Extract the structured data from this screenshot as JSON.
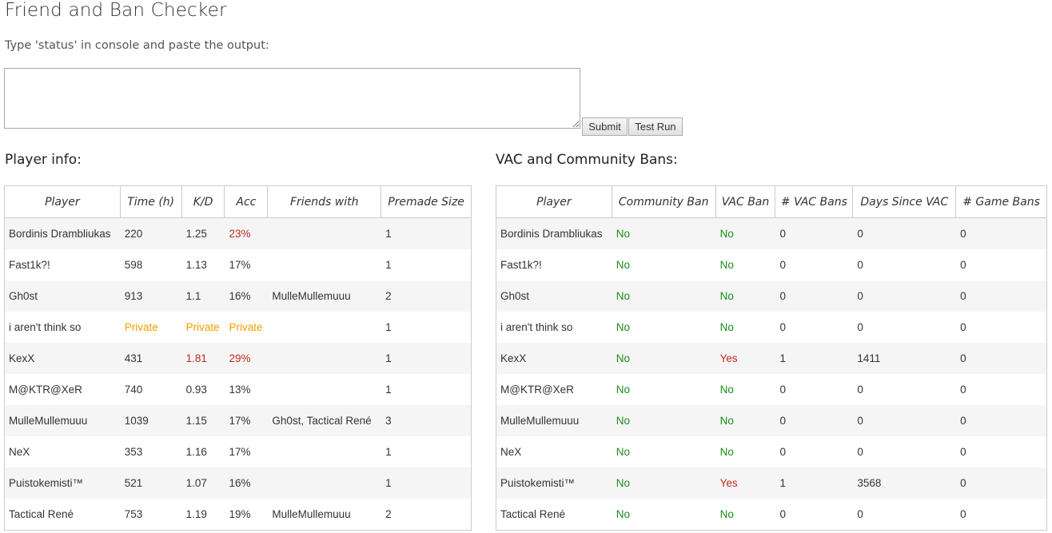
{
  "page": {
    "title": "Friend and Ban Checker",
    "instruction": "Type 'status' in console and paste the output:",
    "console_value": "",
    "submit_label": "Submit",
    "testrun_label": "Test Run"
  },
  "player_info": {
    "heading": "Player info:",
    "columns": [
      "Player",
      "Time (h)",
      "K/D",
      "Acc",
      "Friends with",
      "Premade Size"
    ],
    "rows": [
      {
        "player": "Bordinis Drambliukas",
        "time": "220",
        "kd": "1.25",
        "acc": "23%",
        "friends": "",
        "premade": "1",
        "time_c": "",
        "kd_c": "",
        "acc_c": "red"
      },
      {
        "player": "Fast1k?!",
        "time": "598",
        "kd": "1.13",
        "acc": "17%",
        "friends": "",
        "premade": "1",
        "time_c": "",
        "kd_c": "",
        "acc_c": ""
      },
      {
        "player": "Gh0st",
        "time": "913",
        "kd": "1.1",
        "acc": "16%",
        "friends": "MulleMullemuuu",
        "premade": "2",
        "time_c": "",
        "kd_c": "",
        "acc_c": ""
      },
      {
        "player": "i aren't think so",
        "time": "Private",
        "kd": "Private",
        "acc": "Private",
        "friends": "",
        "premade": "1",
        "time_c": "orange",
        "kd_c": "orange",
        "acc_c": "orange"
      },
      {
        "player": "KexX",
        "time": "431",
        "kd": "1.81",
        "acc": "29%",
        "friends": "",
        "premade": "1",
        "time_c": "",
        "kd_c": "red",
        "acc_c": "red"
      },
      {
        "player": "M@KTR@XeR",
        "time": "740",
        "kd": "0.93",
        "acc": "13%",
        "friends": "",
        "premade": "1",
        "time_c": "",
        "kd_c": "",
        "acc_c": ""
      },
      {
        "player": "MulleMullemuuu",
        "time": "1039",
        "kd": "1.15",
        "acc": "17%",
        "friends": "Gh0st, Tactical René",
        "premade": "3",
        "time_c": "",
        "kd_c": "",
        "acc_c": ""
      },
      {
        "player": "NeX",
        "time": "353",
        "kd": "1.16",
        "acc": "17%",
        "friends": "",
        "premade": "1",
        "time_c": "",
        "kd_c": "",
        "acc_c": ""
      },
      {
        "player": "Puistokemisti™",
        "time": "521",
        "kd": "1.07",
        "acc": "16%",
        "friends": "",
        "premade": "1",
        "time_c": "",
        "kd_c": "",
        "acc_c": ""
      },
      {
        "player": "Tactical René",
        "time": "753",
        "kd": "1.19",
        "acc": "19%",
        "friends": "MulleMullemuuu",
        "premade": "2",
        "time_c": "",
        "kd_c": "",
        "acc_c": ""
      }
    ]
  },
  "bans": {
    "heading": "VAC and Community Bans:",
    "columns": [
      "Player",
      "Community Ban",
      "VAC Ban",
      "# VAC Bans",
      "Days Since VAC",
      "# Game Bans"
    ],
    "rows": [
      {
        "player": "Bordinis Drambliukas",
        "community": "No",
        "vac": "No",
        "vac_bans": "0",
        "days": "0",
        "game_bans": "0",
        "vac_c": "green"
      },
      {
        "player": "Fast1k?!",
        "community": "No",
        "vac": "No",
        "vac_bans": "0",
        "days": "0",
        "game_bans": "0",
        "vac_c": "green"
      },
      {
        "player": "Gh0st",
        "community": "No",
        "vac": "No",
        "vac_bans": "0",
        "days": "0",
        "game_bans": "0",
        "vac_c": "green"
      },
      {
        "player": "i aren't think so",
        "community": "No",
        "vac": "No",
        "vac_bans": "0",
        "days": "0",
        "game_bans": "0",
        "vac_c": "green"
      },
      {
        "player": "KexX",
        "community": "No",
        "vac": "Yes",
        "vac_bans": "1",
        "days": "1411",
        "game_bans": "0",
        "vac_c": "red"
      },
      {
        "player": "M@KTR@XeR",
        "community": "No",
        "vac": "No",
        "vac_bans": "0",
        "days": "0",
        "game_bans": "0",
        "vac_c": "green"
      },
      {
        "player": "MulleMullemuuu",
        "community": "No",
        "vac": "No",
        "vac_bans": "0",
        "days": "0",
        "game_bans": "0",
        "vac_c": "green"
      },
      {
        "player": "NeX",
        "community": "No",
        "vac": "No",
        "vac_bans": "0",
        "days": "0",
        "game_bans": "0",
        "vac_c": "green"
      },
      {
        "player": "Puistokemisti™",
        "community": "No",
        "vac": "Yes",
        "vac_bans": "1",
        "days": "3568",
        "game_bans": "0",
        "vac_c": "red"
      },
      {
        "player": "Tactical René",
        "community": "No",
        "vac": "No",
        "vac_bans": "0",
        "days": "0",
        "game_bans": "0",
        "vac_c": "green"
      }
    ]
  },
  "colors": {
    "ok": "#1a8c1a",
    "bad": "#c0281c",
    "private": "#f0a000"
  }
}
